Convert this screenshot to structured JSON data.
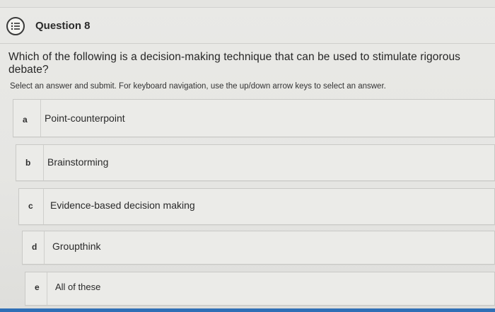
{
  "header": {
    "title": "Question 8",
    "icon": "list-icon"
  },
  "question": {
    "text": "Which of the following is a decision-making technique that can be used to stimulate rigorous debate?"
  },
  "instruction": {
    "text": "Select an answer and submit. For keyboard navigation, use the up/down arrow keys to select an answer."
  },
  "options": [
    {
      "letter": "a",
      "text": "Point-counterpoint"
    },
    {
      "letter": "b",
      "text": "Brainstorming"
    },
    {
      "letter": "c",
      "text": "Evidence-based decision making"
    },
    {
      "letter": "d",
      "text": "Groupthink"
    },
    {
      "letter": "e",
      "text": "All of these"
    }
  ],
  "colors": {
    "accent_bar": "#2f6fb6",
    "background": "#e8e8e5",
    "option_bg": "#ebebe8"
  }
}
